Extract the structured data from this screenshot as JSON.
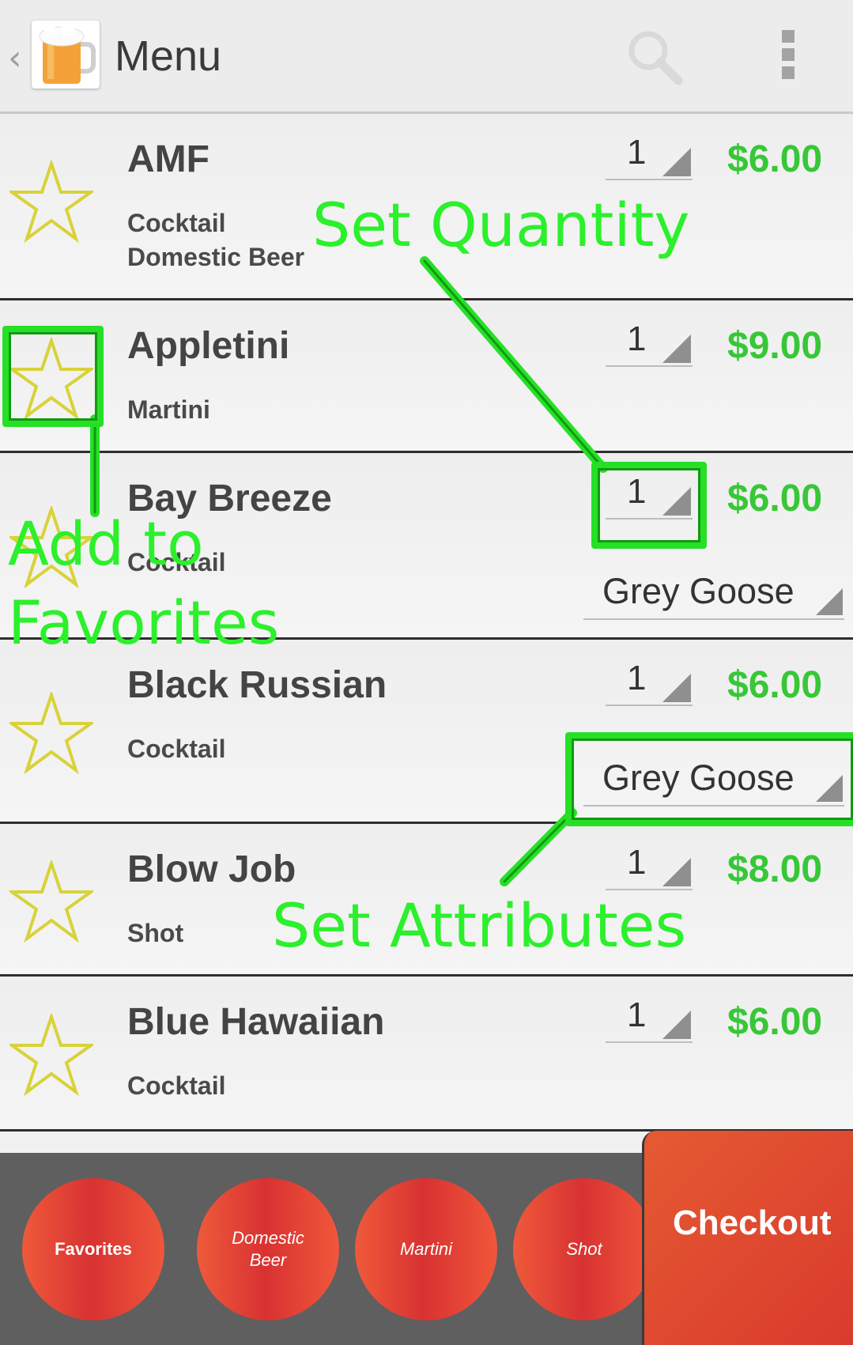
{
  "actionbar": {
    "back_glyph": "‹",
    "title": "Menu",
    "icons": [
      "back-caret-icon",
      "beer-mug-icon",
      "search-icon",
      "overflow-menu-icon"
    ]
  },
  "items": [
    {
      "name": "AMF",
      "categories": [
        "Cocktail",
        "Domestic Beer"
      ],
      "quantity": "1",
      "price": "$6.00"
    },
    {
      "name": "Appletini",
      "categories": [
        "Martini"
      ],
      "quantity": "1",
      "price": "$9.00"
    },
    {
      "name": "Bay Breeze",
      "categories": [
        "Cocktail"
      ],
      "quantity": "1",
      "price": "$6.00",
      "attribute": "Grey Goose"
    },
    {
      "name": "Black Russian",
      "categories": [
        "Cocktail"
      ],
      "quantity": "1",
      "price": "$6.00",
      "attribute": "Grey Goose"
    },
    {
      "name": "Blow Job",
      "categories": [
        "Shot"
      ],
      "quantity": "1",
      "price": "$8.00"
    },
    {
      "name": "Blue Hawaiian",
      "categories": [
        "Cocktail"
      ],
      "quantity": "1",
      "price": "$6.00"
    }
  ],
  "annotations": {
    "set_quantity": "Set Quantity",
    "add_to_favorites_line1": "Add to",
    "add_to_favorites_line2": "Favorites",
    "set_attributes": "Set Attributes"
  },
  "bottom_nav": {
    "filters": [
      {
        "label": "Favorites",
        "style": "bold"
      },
      {
        "label": "Domestic Beer",
        "style": "italic"
      },
      {
        "label": "Martini",
        "style": "italic"
      },
      {
        "label": "Shot",
        "style": "italic"
      }
    ],
    "checkout_label": "Checkout"
  },
  "colors": {
    "price": "#37c737",
    "annotation": "#2bf02b",
    "star": "#d8d23a",
    "button_red": "#d83232",
    "bottom_bar": "#5f5f5f"
  }
}
